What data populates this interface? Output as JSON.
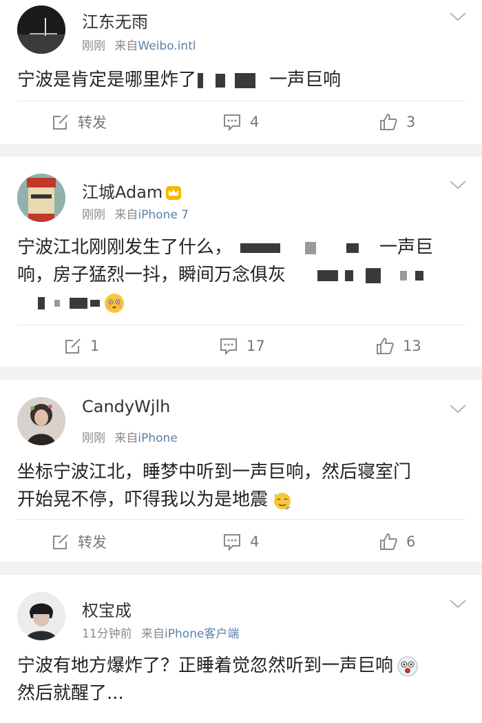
{
  "posts": [
    {
      "username": "江东无雨",
      "time": "刚刚",
      "source_prefix": "来自",
      "source": "Weibo.intl",
      "text_a": "宁波是肯定是哪里炸了",
      "text_b": "一声巨响",
      "repost_label": "转发",
      "comments": "4",
      "likes": "3"
    },
    {
      "username": "江城Adam",
      "time": "刚刚",
      "source_prefix": "来自",
      "source": "iPhone 7",
      "text_a": "宁波江北刚刚发生了什么，",
      "text_b": "一声巨",
      "text_c": "响，房子猛烈一抖，瞬间万念俱灰",
      "reposts": "1",
      "comments": "17",
      "likes": "13"
    },
    {
      "username": "CandyWjlh",
      "time": "刚刚",
      "source_prefix": "来自",
      "source": "iPhone",
      "text_a": "坐标宁波江北，睡梦中听到一声巨响，然后寝室门",
      "text_b": "开始晃不停，吓得我以为是地震",
      "repost_label": "转发",
      "comments": "4",
      "likes": "6"
    },
    {
      "username": "权宝成",
      "time": "11分钟前",
      "source_prefix": "来自",
      "source": "iPhone客户端",
      "text_a": "宁波有地方爆炸了？正睡着觉忽然听到一声巨响",
      "text_b": "然后就醒了..."
    }
  ]
}
